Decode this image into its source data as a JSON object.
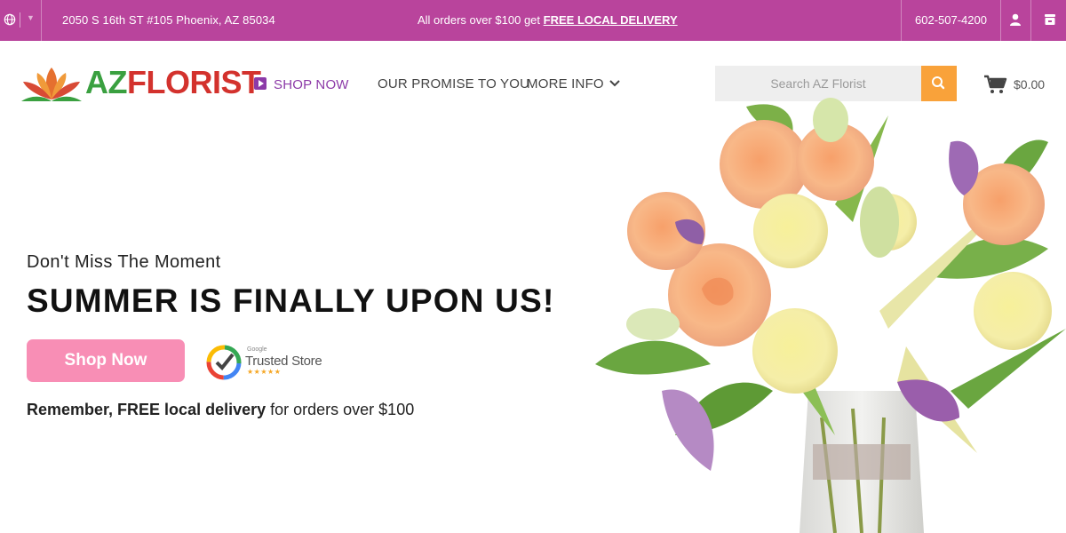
{
  "topbar": {
    "address": "2050 S 16th ST #105 Phoenix, AZ 85034",
    "promo_text": "All orders over $100 get",
    "promo_link": "FREE LOCAL DELIVERY",
    "phone": "602-507-4200",
    "background_color": "#b9449c",
    "icons": [
      "globe-icon",
      "user-icon",
      "store-icon"
    ]
  },
  "brand": {
    "logo_prefix": "AZ",
    "logo_name": "FLORIST"
  },
  "nav": {
    "shop_now": "SHOP NOW",
    "promise": "OUR PROMISE TO YOU",
    "more_info": "MORE INFO",
    "accent_color": "#8c3aa8"
  },
  "search": {
    "placeholder": "Search AZ Florist",
    "button_color": "#f9a23a"
  },
  "cart": {
    "total": "$0.00"
  },
  "hero": {
    "subtitle": "Don't Miss The Moment",
    "title": "SUMMER IS FINALLY UPON US!",
    "button_label": "Shop Now",
    "button_color": "#f88eb5",
    "badge_small": "Google",
    "badge_text": "Trusted Store",
    "badge_stars": "★★★★★",
    "delivery_bold": "Remember, FREE local delivery",
    "delivery_rest": " for orders over $100"
  }
}
